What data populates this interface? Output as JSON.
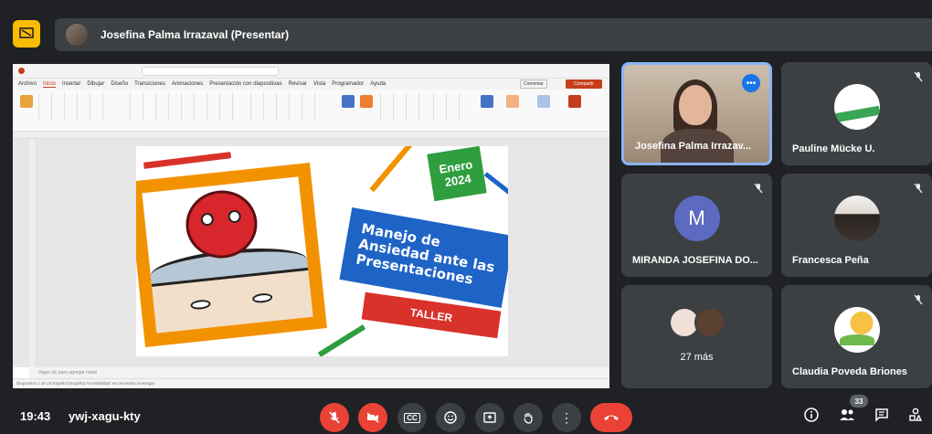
{
  "window": {
    "presenter_label": "Josefina Palma Irrazaval (Presentar)"
  },
  "powerpoint": {
    "menu": [
      "Archivo",
      "Inicio",
      "Insertar",
      "Dibujar",
      "Diseño",
      "Transiciones",
      "Animaciones",
      "Presentación con diapositivas",
      "Revisar",
      "Vista",
      "Programador",
      "Ayuda"
    ],
    "active_tab": "Inicio",
    "comments_label": "Comentar",
    "share_label": "Compartir",
    "notes_placeholder": "Haga clic para agregar notas",
    "status_text": "Diapositiva 1 de 15    Español (España)    Accesibilidad: es necesario investigar"
  },
  "slide": {
    "badge_line1": "Enero",
    "badge_line2": "2024",
    "title": "Manejo de Ansiedad ante las Presentaciones",
    "subtitle": "TALLER"
  },
  "participants": [
    {
      "name": "Josefina Palma Irrazav...",
      "speaking": true
    },
    {
      "name": "Pauline Mücke U."
    },
    {
      "name": "MIRANDA JOSEFINA DO...",
      "initial": "M"
    },
    {
      "name": "Francesca Peña"
    },
    {
      "more": "27 más"
    },
    {
      "name": "Claudia Poveda Briones"
    }
  ],
  "footer": {
    "time": "19:43",
    "meeting_code": "ywj-xagu-kty",
    "people_count": "33",
    "cc_label": "CC"
  },
  "colors": {
    "background": "#202124",
    "tile": "#3c4043",
    "accent_yellow": "#fbbc04",
    "danger_red": "#ea4335",
    "speaking_border": "#8ab4f8",
    "avatar_purple": "#5c6bc0"
  }
}
